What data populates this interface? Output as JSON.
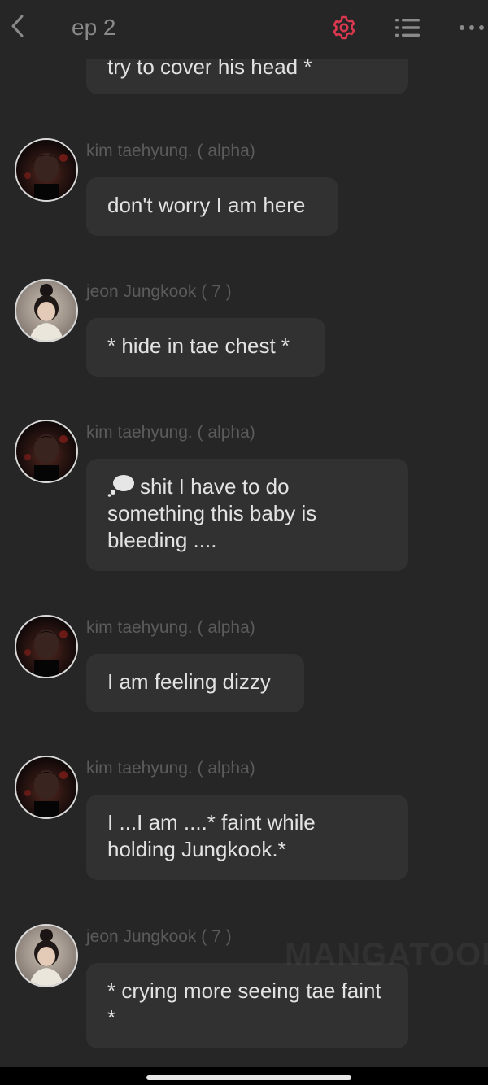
{
  "header": {
    "title": "ep 2",
    "accent_color": "#d9384f"
  },
  "messages": [
    {
      "sender": "",
      "avatar": "",
      "text": "try to cover his head *"
    },
    {
      "sender": "kim taehyung. ( alpha)",
      "avatar": "tae",
      "text": "don't worry I am here"
    },
    {
      "sender": "jeon Jungkook ( 7 )",
      "avatar": "jk",
      "text": "* hide in tae chest *"
    },
    {
      "sender": "kim taehyung. ( alpha)",
      "avatar": "tae",
      "icon": "thought-bubble-icon",
      "text": "shit I have to do something this baby is bleeding ...."
    },
    {
      "sender": "kim taehyung. ( alpha)",
      "avatar": "tae",
      "text": "I am feeling dizzy"
    },
    {
      "sender": "kim taehyung. ( alpha)",
      "avatar": "tae",
      "text": "I ...I am ....* faint while holding Jungkook.*"
    },
    {
      "sender": "jeon Jungkook ( 7 )",
      "avatar": "jk",
      "text": "* crying more seeing tae faint *"
    }
  ],
  "watermark": "MANGATOON"
}
